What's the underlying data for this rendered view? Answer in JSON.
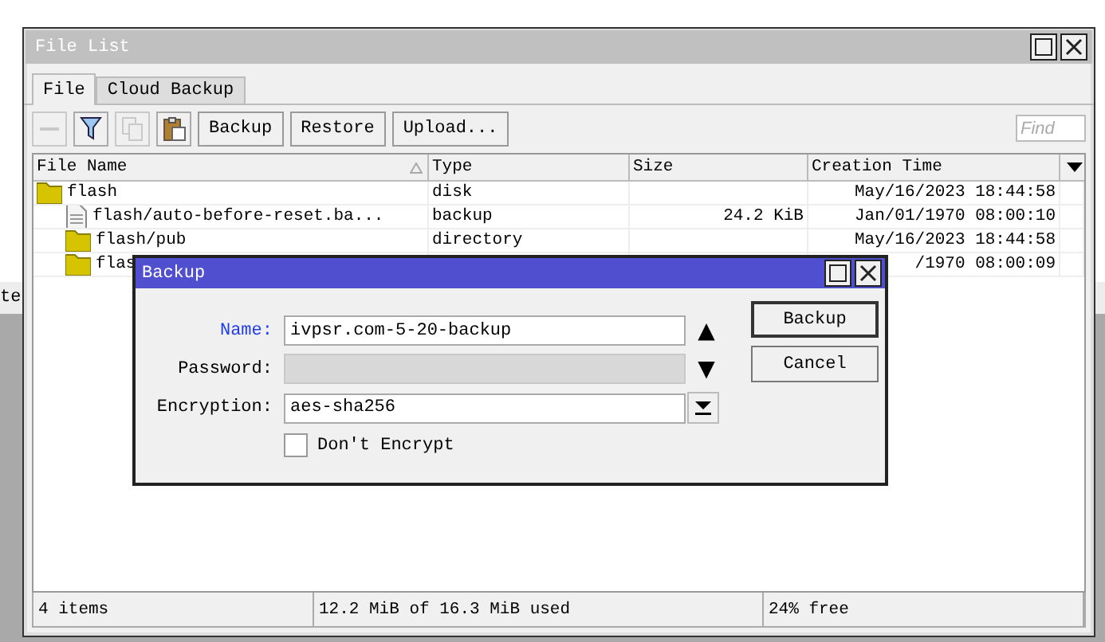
{
  "background": {
    "text": "te"
  },
  "window": {
    "title": "File List"
  },
  "tabs": [
    {
      "label": "File",
      "selected": true
    },
    {
      "label": "Cloud Backup",
      "selected": false
    }
  ],
  "toolbar": {
    "icon_buttons": [
      {
        "kind": "remove",
        "disabled": true
      },
      {
        "kind": "filter",
        "disabled": false
      },
      {
        "kind": "copy",
        "disabled": true
      },
      {
        "kind": "paste",
        "disabled": false
      }
    ],
    "buttons": [
      "Backup",
      "Restore",
      "Upload..."
    ],
    "search": {
      "placeholder": "Find"
    }
  },
  "table": {
    "columns": [
      "File Name",
      "Type",
      "Size",
      "Creation Time"
    ],
    "rows": [
      {
        "kind": "folder",
        "name": "flash",
        "type": "disk",
        "time": "May/16/2023 18:44:58",
        "children": [
          {
            "kind": "file",
            "name": "flash/auto-before-reset.ba...",
            "type": "backup",
            "size": "24.2 KiB",
            "time": "Jan/01/1970 08:00:10"
          },
          {
            "kind": "folder",
            "name": "flash/pub",
            "type": "directory",
            "time": "May/16/2023 18:44:58"
          },
          {
            "kind": "folder",
            "name": "flas",
            "time": "/1970 08:00:09"
          }
        ]
      }
    ]
  },
  "status_bar": [
    "4 items",
    "12.2 MiB of 16.3 MiB used",
    "24% free"
  ],
  "dialog": {
    "title": "Backup",
    "fields": [
      {
        "kind": "text",
        "label": "Name:",
        "value": "ivpsr.com-5-20-backup",
        "focused": true,
        "disabled": false,
        "arrow": "▲"
      },
      {
        "kind": "text",
        "label": "Password:",
        "focused": false,
        "disabled": true,
        "arrow": "▼"
      },
      {
        "kind": "dropdown",
        "label": "Encryption:",
        "value": "aes-sha256",
        "focused": false,
        "disabled": false
      }
    ],
    "checkbox": {
      "label": "Don't Encrypt",
      "checked": false
    },
    "buttons": [
      "Backup",
      "Cancel"
    ]
  }
}
